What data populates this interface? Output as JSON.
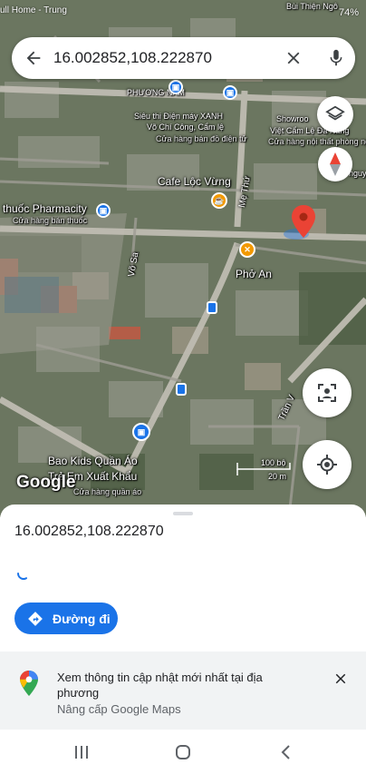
{
  "status_bar": {
    "left_text": "ull Home - Trung",
    "battery": "74%"
  },
  "search": {
    "query": "16.002852,108.222870",
    "back_icon": "arrow-back-icon",
    "clear_icon": "close-icon",
    "mic_icon": "microphone-icon"
  },
  "map": {
    "labels": {
      "bui_thien_ngo": "Bùi Thiện Ngô",
      "phuong_nam": "PHƯƠNG NAM",
      "showroom": "Showroo",
      "viet_cam_le": "Việt Cẩm Lệ Đà Nẵng",
      "viet_cam_le_sub": "Cửa hàng nội thất phòng ngủ",
      "dienmay_name": "Siêu thị Điện máy XANH",
      "dienmay_addr": "Võ Chí Công, Cẩm lệ",
      "dienmay_sub": "Cửa hàng bán đồ điện tử",
      "cafe": "Cafe Lộc Vừng",
      "pharmacity": "thuốc Pharmacity",
      "pharmacity_sub": "Cửa hàng bán thuốc",
      "me_thu": "Mẹ Thứ",
      "vo_sa": "Võ Sa",
      "pho_an": "Phở An",
      "tran_v": "Trần V",
      "baokids_1": "Bao Kids Quần Áo",
      "baokids_2": "Trẻ Em Xuất Khẩu",
      "baokids_sub": "Cửa hàng quần áo",
      "google": "Google",
      "scale_ft": "100 bộ",
      "scale_m": "20 m",
      "nguy": "nguy"
    },
    "marker_color": "#ea4335"
  },
  "sheet": {
    "coords": "16.002852,108.222870",
    "directions_label": "Đường đi",
    "banner_title": "Xem thông tin cập nhật mới nhất tại địa phương",
    "banner_sub": "Nâng cấp Google Maps"
  },
  "colors": {
    "accent": "#1a73e8",
    "banner_bg": "#f1f3f4"
  }
}
